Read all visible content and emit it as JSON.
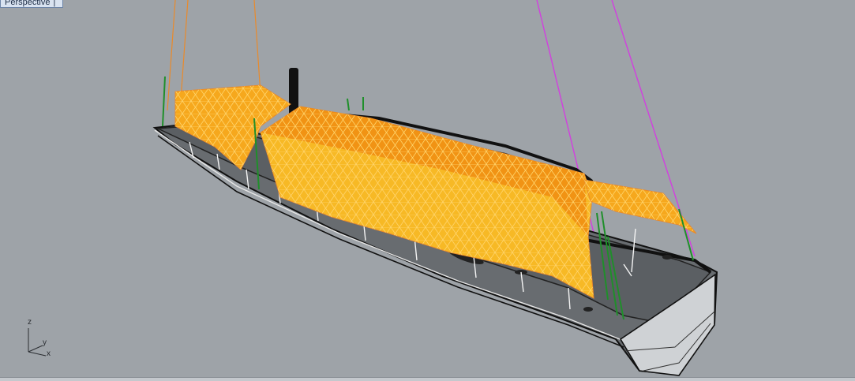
{
  "viewport": {
    "title": "Perspective",
    "tab_separator": "|"
  },
  "axis_widget": {
    "z_label": "z",
    "y_label": "y",
    "x_label": "x"
  },
  "colors": {
    "background": "#9ea3a8",
    "sail_fill": "#f6b21a",
    "sail_shade": "#f08c12",
    "hull_wire": "#111111",
    "deck": "#5b5f63",
    "rigging_orange": "#e98a2b",
    "rigging_magenta": "#d23fe0",
    "stanchion_green": "#1f8f2a"
  }
}
